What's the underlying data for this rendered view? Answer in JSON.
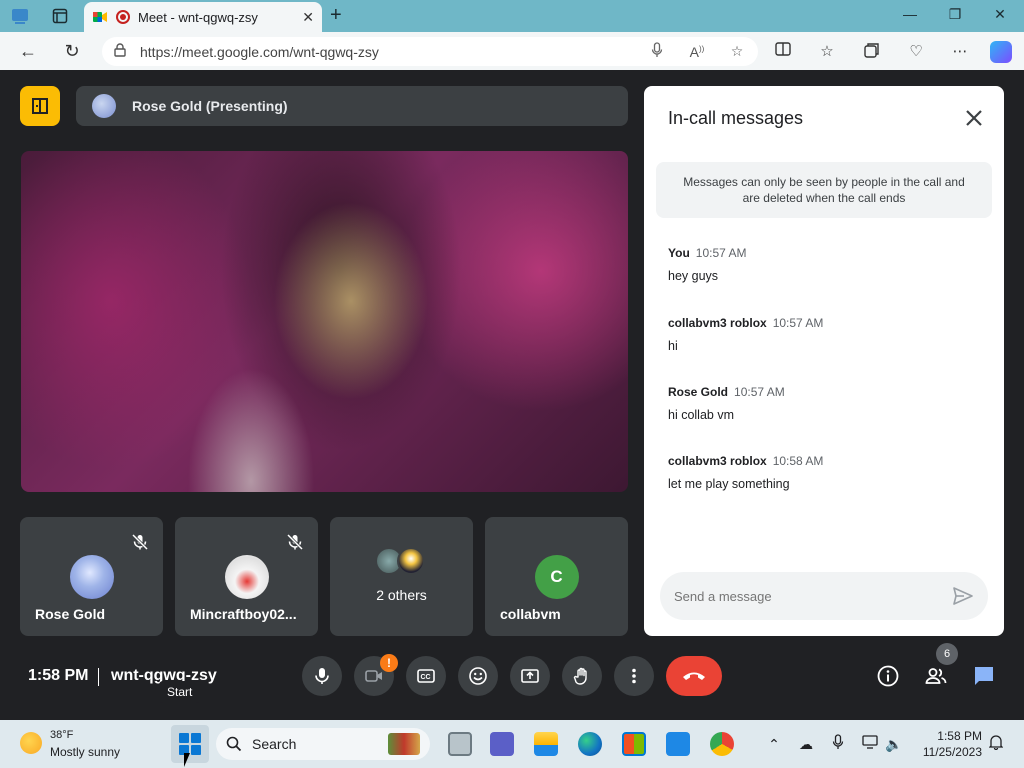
{
  "browser": {
    "tab_title": "Meet - wnt-qgwq-zsy",
    "url": "https://meet.google.com/wnt-qgwq-zsy"
  },
  "meet": {
    "presenting_label": "Rose Gold (Presenting)",
    "tiles": [
      {
        "name": "Rose Gold",
        "muted": true
      },
      {
        "name": "Mincraftboy02...",
        "muted": true
      },
      {
        "name": "2 others"
      },
      {
        "name": "collabvm",
        "initial": "C"
      }
    ],
    "clock": "1:58 PM",
    "meeting_code": "wnt-qgwq-zsy",
    "tooltip": "Start",
    "camera_warning": "!",
    "people_count": "6"
  },
  "chat": {
    "title": "In-call messages",
    "notice": "Messages can only be seen by people in the call and are deleted when the call ends",
    "messages": [
      {
        "sender": "You",
        "time": "10:57 AM",
        "text": "hey guys"
      },
      {
        "sender": "collabvm3 roblox",
        "time": "10:57 AM",
        "text": "hi"
      },
      {
        "sender": "Rose Gold",
        "time": "10:57 AM",
        "text": "hi collab vm"
      },
      {
        "sender": "collabvm3 roblox",
        "time": "10:58 AM",
        "text": "let me play something"
      }
    ],
    "input_placeholder": "Send a message"
  },
  "taskbar": {
    "weather_temp": "38°F",
    "weather_desc": "Mostly sunny",
    "search_label": "Search",
    "time": "1:58 PM",
    "date": "11/25/2023"
  },
  "colors": {
    "meet_bg": "#202124",
    "tile_bg": "#3c4043",
    "end_call": "#ea4335",
    "accent_yellow": "#fbbc04",
    "chat_blue": "#8ab4f8"
  }
}
